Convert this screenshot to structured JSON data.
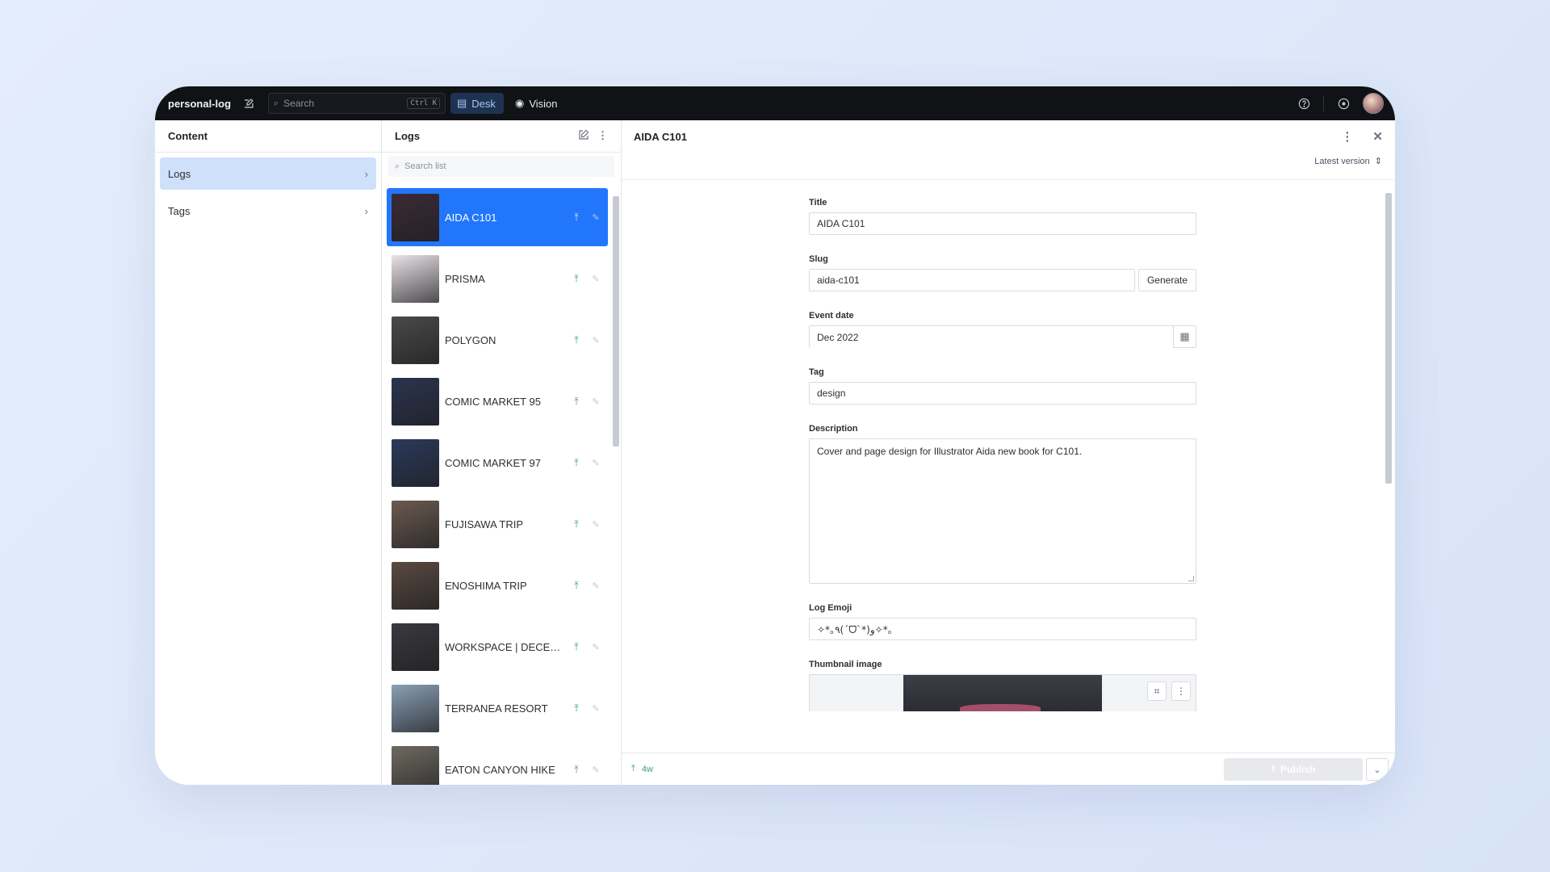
{
  "app": {
    "brand": "personal-log",
    "search_placeholder": "Search",
    "search_shortcut": "Ctrl K",
    "desk_label": "Desk",
    "vision_label": "Vision"
  },
  "content_pane": {
    "title": "Content",
    "items": [
      {
        "label": "Logs",
        "active": true
      },
      {
        "label": "Tags",
        "active": false
      }
    ]
  },
  "logs_pane": {
    "title": "Logs",
    "search_placeholder": "Search list",
    "items": [
      {
        "name": "AIDA C101",
        "selected": true,
        "thumb": "#3a2a35"
      },
      {
        "name": "PRISMA",
        "selected": false,
        "thumb": "#e9e3e6"
      },
      {
        "name": "POLYGON",
        "selected": false,
        "thumb": "#4a4a4a"
      },
      {
        "name": "COMIC MARKET 95",
        "selected": false,
        "thumb": "#2b3450"
      },
      {
        "name": "COMIC MARKET 97",
        "selected": false,
        "thumb": "#2a3a5a"
      },
      {
        "name": "FUJISAWA TRIP",
        "selected": false,
        "thumb": "#6b5a50"
      },
      {
        "name": "ENOSHIMA TRIP",
        "selected": false,
        "thumb": "#5a4a40"
      },
      {
        "name": "WORKSPACE | DECEMBE...",
        "selected": false,
        "thumb": "#3a3a3e"
      },
      {
        "name": "TERRANEA RESORT",
        "selected": false,
        "thumb": "#8aa0b5"
      },
      {
        "name": "EATON CANYON HIKE",
        "selected": false,
        "thumb": "#6e6a60"
      }
    ]
  },
  "document": {
    "title": "AIDA C101",
    "version": "Latest version",
    "fields": {
      "title_label": "Title",
      "title_value": "AIDA C101",
      "slug_label": "Slug",
      "slug_value": "aida-c101",
      "generate_label": "Generate",
      "date_label": "Event date",
      "date_value": "Dec 2022",
      "tag_label": "Tag",
      "tag_value": "design",
      "desc_label": "Description",
      "desc_value": "Cover and page design for Illustrator Aida new book for C101.",
      "emoji_label": "Log Emoji",
      "emoji_value": "✧*｡٩(ˊᗜˋ*)و✧*｡",
      "thumb_label": "Thumbnail image"
    },
    "footer": {
      "published_ago": "4w",
      "publish_label": "Publish"
    }
  },
  "colors": {
    "accent": "#2276fc",
    "active_nav": "#cfe0fb",
    "published": "#3aa06a",
    "topbar": "#101216"
  }
}
